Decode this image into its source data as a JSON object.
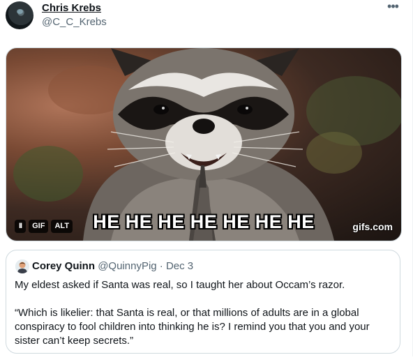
{
  "tweet": {
    "author_name": "Chris Krebs",
    "author_handle": "@C_C_Krebs",
    "more_icon": "more-horizontal-icon"
  },
  "media": {
    "caption": "HE HE HE HE HE HE HE",
    "watermark": "gifs.com",
    "pause_label": "II",
    "gif_label": "GIF",
    "alt_label": "ALT"
  },
  "quote": {
    "author_name": "Corey Quinn",
    "author_handle": "@QuinnyPig",
    "separator": "·",
    "date": "Dec 3",
    "paragraph1": "My eldest asked if Santa was real, so I taught her about Occam’s razor.",
    "paragraph2": "“Which is likelier: that Santa is real, or that millions of adults are in a global conspiracy to fool children into thinking he is? I remind you that you and your sister can’t keep secrets.”"
  }
}
